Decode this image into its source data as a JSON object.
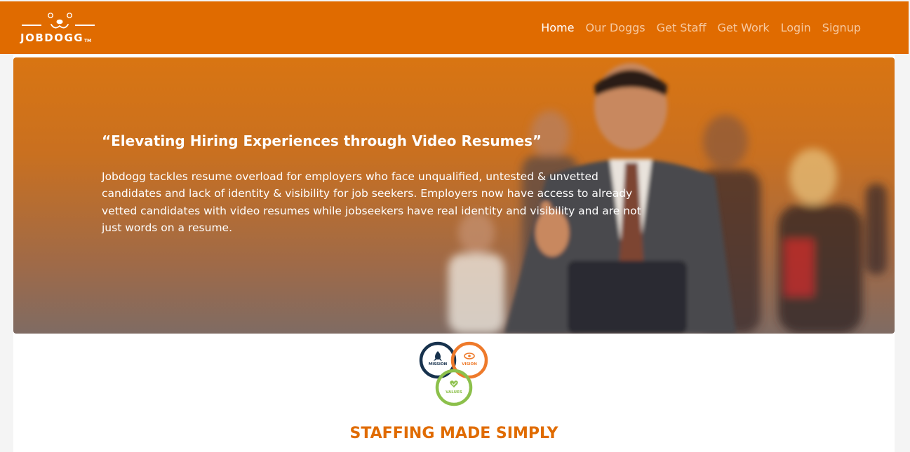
{
  "brand": {
    "name": "JOBDOGG",
    "trademark": "TM",
    "primary_color": "#e06b00"
  },
  "nav": {
    "items": [
      {
        "label": "Home",
        "active": true
      },
      {
        "label": "Our Doggs",
        "active": false
      },
      {
        "label": "Get Staff",
        "active": false
      },
      {
        "label": "Get Work",
        "active": false
      },
      {
        "label": "Login",
        "active": false
      },
      {
        "label": "Signup",
        "active": false
      }
    ]
  },
  "hero": {
    "quote": "“Elevating Hiring Experiences through Video Resumes”",
    "body": "Jobdogg tackles resume overload for employers who face unqualified, untested & unvetted candidates and lack of identity & visibility for job seekers. Employers now have access to already vetted candidates with video resumes while jobseekers have real identity and visibility and are not just words on a resume."
  },
  "mvv": {
    "mission": {
      "label": "MISSION",
      "color": "#17324d",
      "icon": "rocket-icon"
    },
    "vision": {
      "label": "VISION",
      "color": "#ee7a2b",
      "icon": "eye-icon"
    },
    "values": {
      "label": "VALUES",
      "color": "#8cc04b",
      "icon": "heart-check-icon"
    }
  },
  "section": {
    "title": "STAFFING MADE SIMPLY"
  }
}
